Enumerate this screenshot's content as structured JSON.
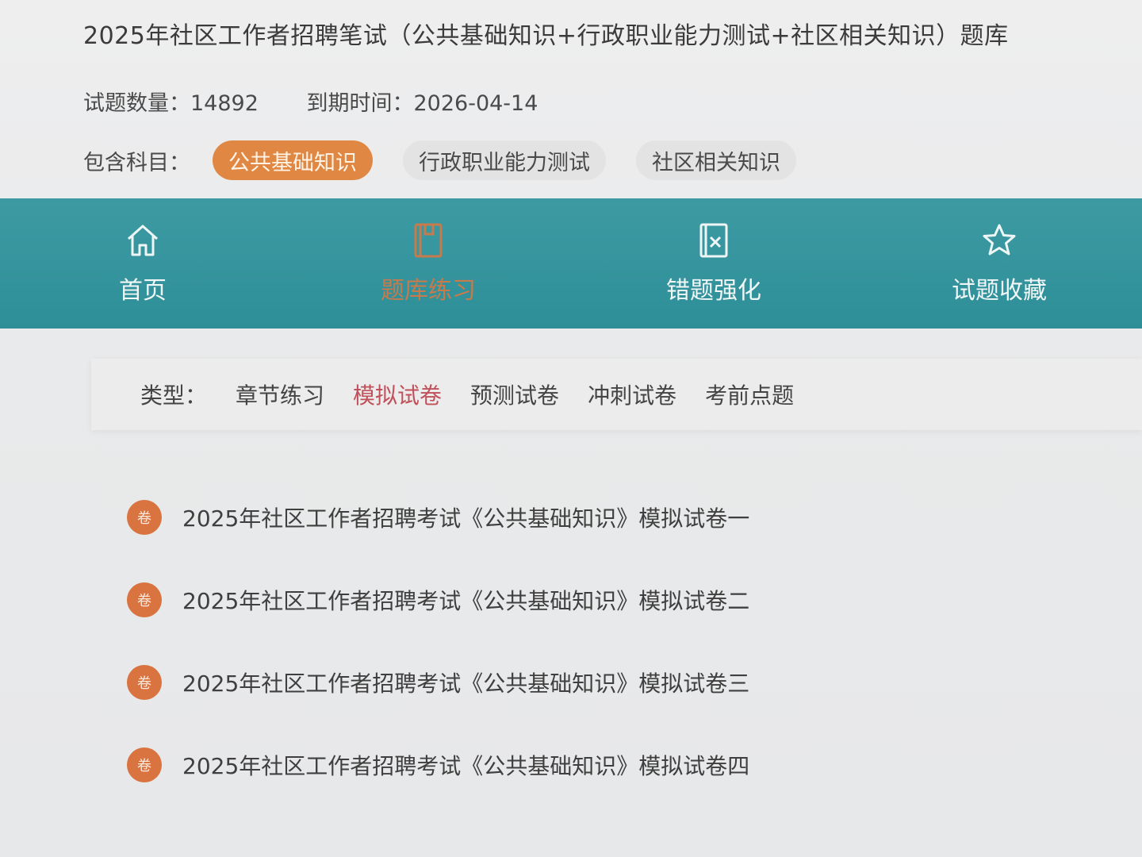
{
  "header": {
    "title": "2025年社区工作者招聘笔试（公共基础知识+行政职业能力测试+社区相关知识）题库",
    "question_count": "试题数量：14892",
    "expiry": "到期时间：2026-04-14"
  },
  "subjects": {
    "label": "包含科目：",
    "items": [
      "公共基础知识",
      "行政职业能力测试",
      "社区相关知识"
    ],
    "active_index": 0
  },
  "nav": {
    "items": [
      {
        "label": "首页",
        "icon": "home-icon"
      },
      {
        "label": "题库练习",
        "icon": "book-icon"
      },
      {
        "label": "错题强化",
        "icon": "wrong-question-icon"
      },
      {
        "label": "试题收藏",
        "icon": "star-icon"
      }
    ],
    "active_index": 1
  },
  "types": {
    "label": "类型：",
    "tabs": [
      "章节练习",
      "模拟试卷",
      "预测试卷",
      "冲刺试卷",
      "考前点题"
    ],
    "active_index": 1
  },
  "papers": {
    "badge": "卷",
    "items": [
      "2025年社区工作者招聘考试《公共基础知识》模拟试卷一",
      "2025年社区工作者招聘考试《公共基础知识》模拟试卷二",
      "2025年社区工作者招聘考试《公共基础知识》模拟试卷三",
      "2025年社区工作者招聘考试《公共基础知识》模拟试卷四"
    ]
  },
  "colors": {
    "accent": "#e08843",
    "nav_bg": "#3596a0",
    "active_tab": "#c0515a"
  }
}
